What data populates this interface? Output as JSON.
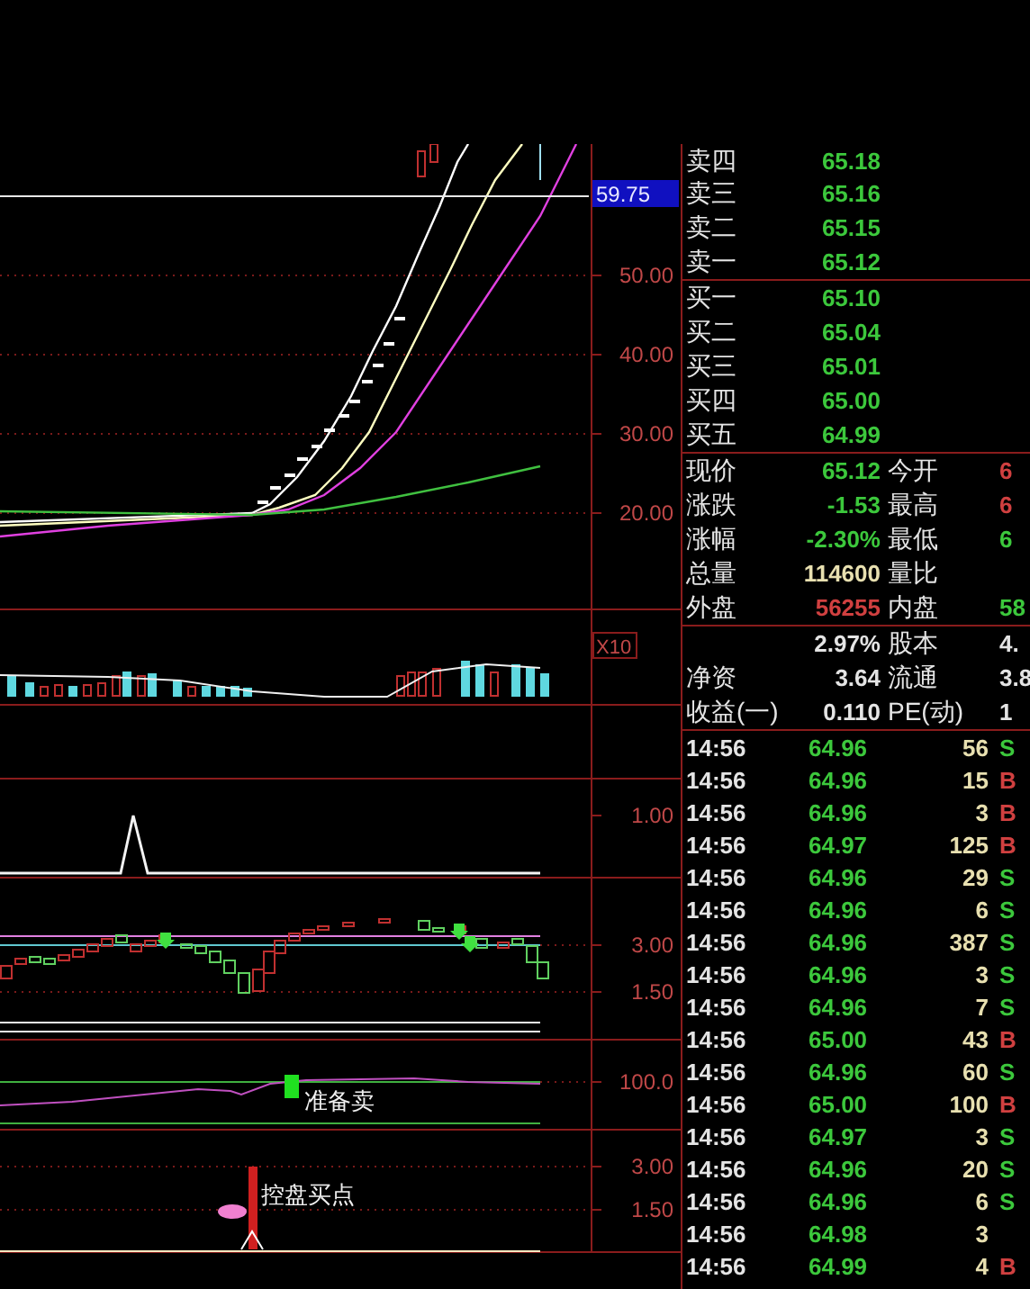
{
  "main_chart": {
    "price_tag": "59.75",
    "axis_labels": [
      "50.00",
      "40.00",
      "30.00",
      "20.00"
    ]
  },
  "volume_panel": {
    "scale_label": "X10"
  },
  "indicator_panels": [
    {
      "kind": "empty"
    },
    {
      "kind": "spike",
      "axis_labels": [
        "1.00"
      ]
    },
    {
      "kind": "steps",
      "axis_labels": [
        "3.00",
        "1.50"
      ]
    },
    {
      "kind": "band",
      "axis_labels": [
        "100.0"
      ],
      "signal": "准备卖"
    },
    {
      "kind": "buy_point",
      "axis_labels": [
        "3.00",
        "1.50"
      ],
      "signal": "控盘买点"
    }
  ],
  "quote": {
    "asks": [
      {
        "label": "卖四",
        "price": "65.18"
      },
      {
        "label": "卖三",
        "price": "65.16"
      },
      {
        "label": "卖二",
        "price": "65.15"
      },
      {
        "label": "卖一",
        "price": "65.12"
      }
    ],
    "bids": [
      {
        "label": "买一",
        "price": "65.10"
      },
      {
        "label": "买二",
        "price": "65.04"
      },
      {
        "label": "买三",
        "price": "65.01"
      },
      {
        "label": "买四",
        "price": "65.00"
      },
      {
        "label": "买五",
        "price": "64.99"
      }
    ],
    "stats": [
      {
        "cells": [
          {
            "label": "现价",
            "value": "65.12",
            "color": "#3cc83c"
          },
          {
            "label": "今开",
            "value": "6",
            "color": "#d04040"
          }
        ]
      },
      {
        "cells": [
          {
            "label": "涨跌",
            "value": "-1.53",
            "color": "#3cc83c"
          },
          {
            "label": "最高",
            "value": "6",
            "color": "#d04040"
          }
        ]
      },
      {
        "cells": [
          {
            "label": "涨幅",
            "value": "-2.30%",
            "color": "#3cc83c"
          },
          {
            "label": "最低",
            "value": "6",
            "color": "#3cc83c"
          }
        ]
      },
      {
        "cells": [
          {
            "label": "总量",
            "value": "114600",
            "color": "#e8e0b0"
          },
          {
            "label": "量比"
          }
        ]
      },
      {
        "cells": [
          {
            "label": "外盘",
            "value": "56255",
            "color": "#d04040"
          },
          {
            "label": "内盘",
            "value": "58",
            "color": "#3cc83c"
          }
        ]
      }
    ],
    "fundamentals": [
      {
        "cells": [
          {
            "value": "2.97%"
          },
          {
            "label": "股本",
            "value": "4."
          }
        ]
      },
      {
        "cells": [
          {
            "label": "净资",
            "value": "3.64"
          },
          {
            "label": "流通",
            "value": "3.8"
          }
        ]
      },
      {
        "cells": [
          {
            "label": "收益(一)",
            "value": "0.110"
          },
          {
            "label": "PE(动)",
            "value": "1"
          }
        ]
      }
    ]
  },
  "trades": [
    {
      "time": "14:56",
      "price": "64.96",
      "volume": "56",
      "side": "S",
      "color": "#3cc83c"
    },
    {
      "time": "14:56",
      "price": "64.96",
      "volume": "15",
      "side": "B",
      "color": "#d04040"
    },
    {
      "time": "14:56",
      "price": "64.96",
      "volume": "3",
      "side": "B",
      "color": "#d04040"
    },
    {
      "time": "14:56",
      "price": "64.97",
      "volume": "125",
      "side": "B",
      "color": "#d04040"
    },
    {
      "time": "14:56",
      "price": "64.96",
      "volume": "29",
      "side": "S",
      "color": "#3cc83c"
    },
    {
      "time": "14:56",
      "price": "64.96",
      "volume": "6",
      "side": "S",
      "color": "#3cc83c"
    },
    {
      "time": "14:56",
      "price": "64.96",
      "volume": "387",
      "side": "S",
      "color": "#3cc83c"
    },
    {
      "time": "14:56",
      "price": "64.96",
      "volume": "3",
      "side": "S",
      "color": "#3cc83c"
    },
    {
      "time": "14:56",
      "price": "64.96",
      "volume": "7",
      "side": "S",
      "color": "#3cc83c"
    },
    {
      "time": "14:56",
      "price": "65.00",
      "volume": "43",
      "side": "B",
      "color": "#d04040"
    },
    {
      "time": "14:56",
      "price": "64.96",
      "volume": "60",
      "side": "S",
      "color": "#3cc83c"
    },
    {
      "time": "14:56",
      "price": "65.00",
      "volume": "100",
      "side": "B",
      "color": "#d04040"
    },
    {
      "time": "14:56",
      "price": "64.97",
      "volume": "3",
      "side": "S",
      "color": "#3cc83c"
    },
    {
      "time": "14:56",
      "price": "64.96",
      "volume": "20",
      "side": "S",
      "color": "#3cc83c"
    },
    {
      "time": "14:56",
      "price": "64.96",
      "volume": "6",
      "side": "S",
      "color": "#3cc83c"
    },
    {
      "time": "14:56",
      "price": "64.98",
      "volume": "3"
    },
    {
      "time": "14:56",
      "price": "64.99",
      "volume": "4",
      "side": "B",
      "color": "#d04040"
    }
  ]
}
